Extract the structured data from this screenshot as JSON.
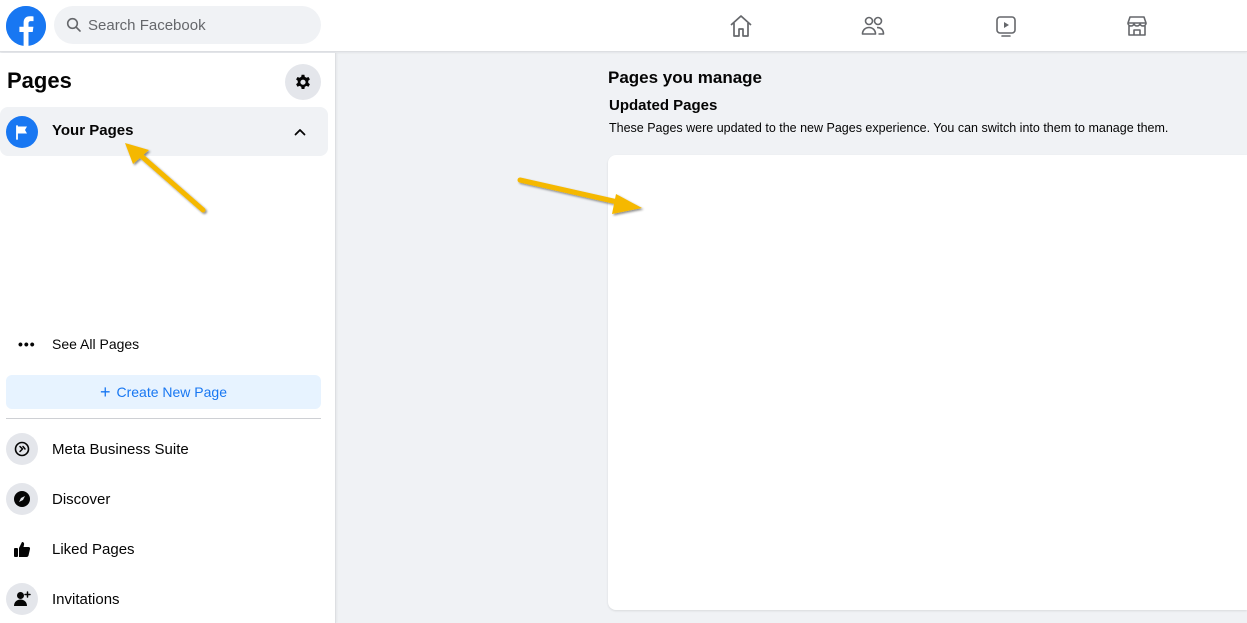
{
  "header": {
    "search_placeholder": "Search Facebook",
    "nav": [
      {
        "name": "home-icon"
      },
      {
        "name": "friends-icon"
      },
      {
        "name": "watch-icon"
      },
      {
        "name": "marketplace-icon"
      }
    ]
  },
  "sidebar": {
    "title": "Pages",
    "your_pages_label": "Your Pages",
    "see_all_dots": "•••",
    "see_all_label": "See All Pages",
    "create_plus": "+",
    "create_label": "Create New Page",
    "items": [
      {
        "label": "Meta Business Suite",
        "icon": "meta-business-suite-icon"
      },
      {
        "label": "Discover",
        "icon": "compass-icon"
      },
      {
        "label": "Liked Pages",
        "icon": "thumbs-up-icon"
      },
      {
        "label": "Invitations",
        "icon": "add-person-icon"
      }
    ]
  },
  "main": {
    "title": "Pages you manage",
    "subtitle": "Updated Pages",
    "description": "These Pages were updated to the new Pages experience. You can switch into them to manage them."
  },
  "colors": {
    "brand": "#1877f2",
    "arrow": "#f5b800",
    "background": "#f0f2f5"
  }
}
